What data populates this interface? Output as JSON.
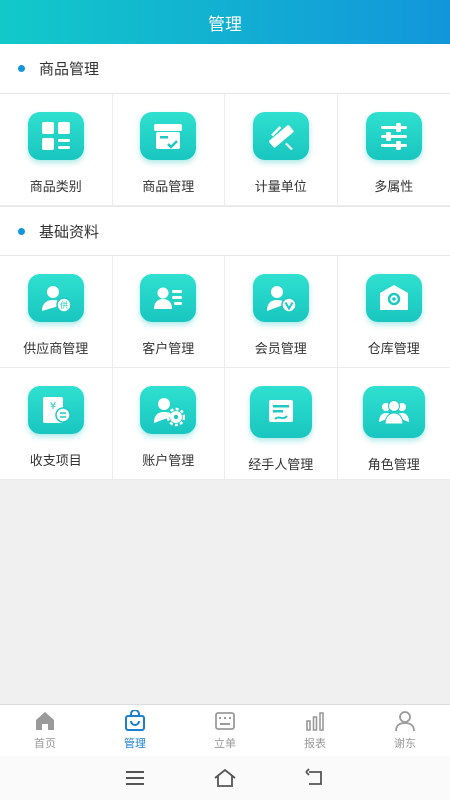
{
  "header": {
    "title": "管理"
  },
  "colors": {
    "accent": "#1296db",
    "tile": "#1fd1c6",
    "tab_active": "#1a7fd0",
    "tab_inactive": "#9a9a9a"
  },
  "sections": [
    {
      "title": "商品管理",
      "items": [
        {
          "label": "商品类别",
          "icon": "grid-list-icon"
        },
        {
          "label": "商品管理",
          "icon": "box-check-icon"
        },
        {
          "label": "计量单位",
          "icon": "ruler-pencil-icon"
        },
        {
          "label": "多属性",
          "icon": "sliders-icon"
        }
      ]
    },
    {
      "title": "基础资料",
      "items": [
        {
          "label": "供应商管理",
          "icon": "supplier-icon"
        },
        {
          "label": "客户管理",
          "icon": "customer-card-icon"
        },
        {
          "label": "会员管理",
          "icon": "member-icon"
        },
        {
          "label": "仓库管理",
          "icon": "warehouse-icon"
        },
        {
          "label": "收支项目",
          "icon": "income-expense-icon"
        },
        {
          "label": "账户管理",
          "icon": "account-settings-icon"
        },
        {
          "label": "经手人管理",
          "icon": "handler-icon"
        },
        {
          "label": "角色管理",
          "icon": "role-group-icon"
        }
      ]
    }
  ],
  "tabs": [
    {
      "label": "首页",
      "icon": "home-icon",
      "active": false
    },
    {
      "label": "管理",
      "icon": "bag-icon",
      "active": true
    },
    {
      "label": "立单",
      "icon": "keyboard-icon",
      "active": false
    },
    {
      "label": "报表",
      "icon": "bar-chart-icon",
      "active": false
    },
    {
      "label": "谢东",
      "icon": "user-icon",
      "active": false
    }
  ]
}
